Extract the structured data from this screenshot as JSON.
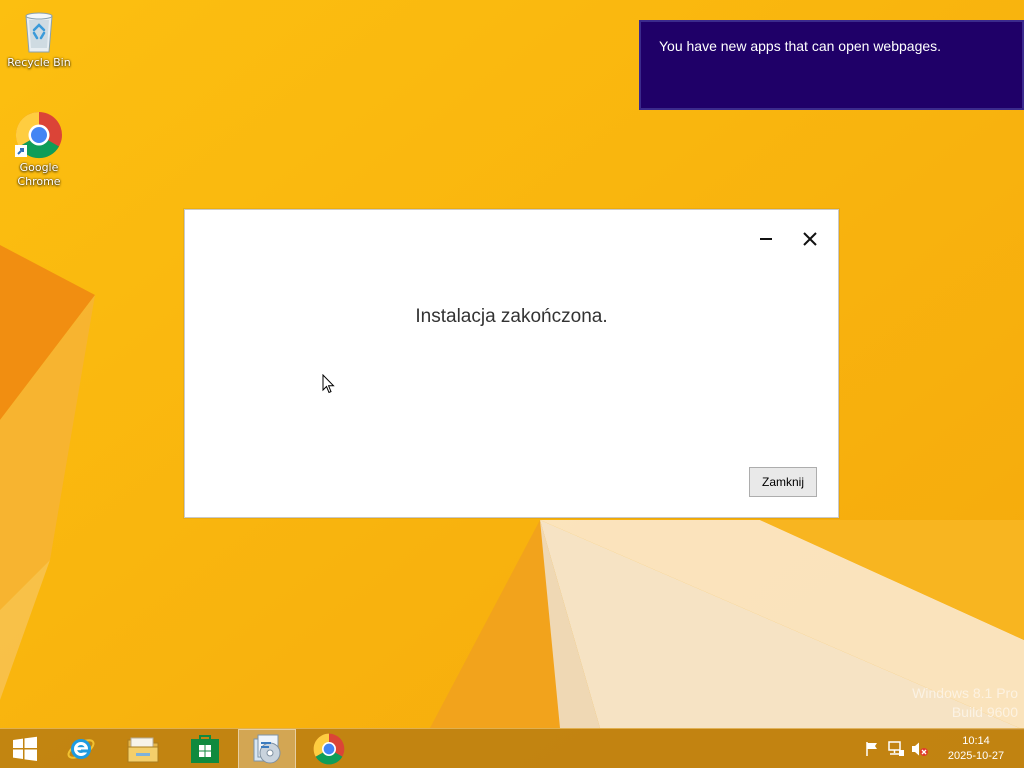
{
  "desktop": {
    "icons": [
      {
        "label": "Recycle Bin"
      },
      {
        "label": "Google Chrome"
      }
    ],
    "watermark": {
      "line1": "Windows 8.1 Pro",
      "line2": "Build 9600"
    }
  },
  "toast": {
    "message": "You have new apps that can open webpages."
  },
  "dialog": {
    "message": "Instalacja zakończona.",
    "close_label": "Zamknij"
  },
  "taskbar": {
    "buttons": [
      {
        "icon": "windows-start-icon"
      },
      {
        "icon": "internet-explorer-icon"
      },
      {
        "icon": "file-explorer-icon"
      },
      {
        "icon": "store-icon"
      },
      {
        "icon": "installer-icon",
        "active": true
      },
      {
        "icon": "chrome-icon"
      }
    ],
    "tray": [
      "action-center-flag-icon",
      "network-icon",
      "volume-muted-icon"
    ],
    "clock": {
      "time": "10:14",
      "date": "2025-10-27"
    }
  },
  "colors": {
    "wallpaper": "#f8b912",
    "toast_bg": "#1f0068",
    "taskbar": "#b67a12"
  }
}
